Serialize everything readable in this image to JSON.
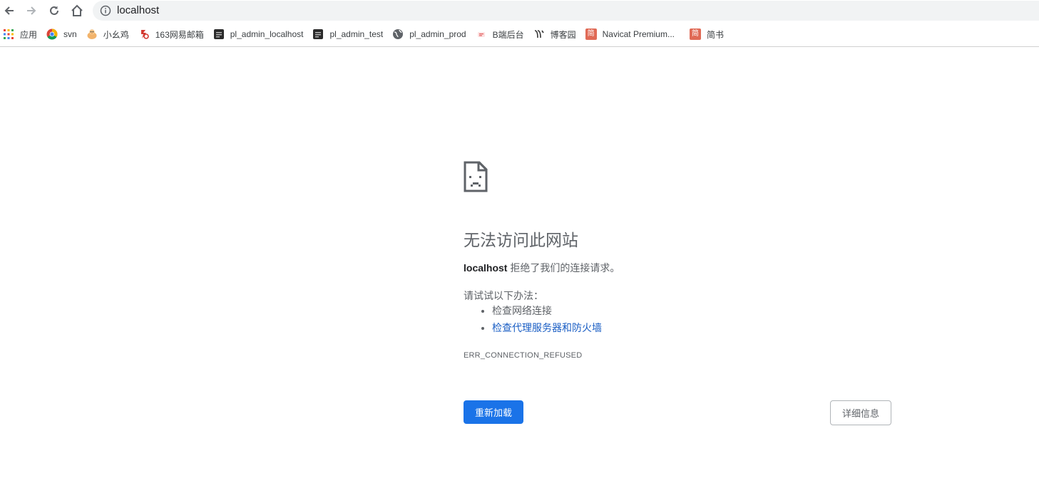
{
  "browser": {
    "address_bar": {
      "url": "localhost"
    },
    "nav_icons": [
      "back-arrow-icon",
      "forward-arrow-icon",
      "reload-icon",
      "home-icon",
      "info-icon"
    ],
    "bookmarks": [
      {
        "label": "应用",
        "icon": "apps-grid-icon"
      },
      {
        "label": "svn",
        "icon": "chrome-icon"
      },
      {
        "label": "小幺鸡",
        "icon": "chick-icon"
      },
      {
        "label": "163网易邮箱",
        "icon": "netease-icon"
      },
      {
        "label": "pl_admin_localhost",
        "icon": "dark-favicon-icon"
      },
      {
        "label": "pl_admin_test",
        "icon": "dark-favicon-icon"
      },
      {
        "label": "pl_admin_prod",
        "icon": "globe-icon"
      },
      {
        "label": "B端后台",
        "icon": "b-favicon-icon"
      },
      {
        "label": "博客园",
        "icon": "cnblogs-icon"
      },
      {
        "label": "Navicat Premium...",
        "icon": "jian-icon"
      },
      {
        "label": "简书",
        "icon": "jian-icon"
      }
    ],
    "bookmark_icon_glyphs": {
      "jian": "简"
    }
  },
  "error_page": {
    "title": "无法访问此网站",
    "host": "localhost",
    "message": " 拒绝了我们的连接请求。",
    "suggestions_title": "请试试以下办法：",
    "suggestions": [
      "检查网络连接",
      "检查代理服务器和防火墙"
    ],
    "error_code": "ERR_CONNECTION_REFUSED",
    "reload_button": "重新加载",
    "details_button": "详细信息"
  },
  "colors": {
    "primary_button": "#1a73e8",
    "link": "#1a5ec4",
    "omnibox_bg": "#f1f3f4",
    "text_secondary": "#5f6368"
  }
}
